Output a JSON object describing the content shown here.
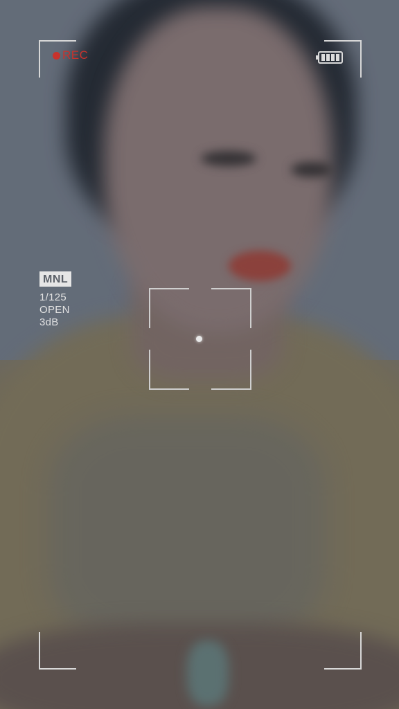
{
  "recording": {
    "label": "REC",
    "color": "#c8322c"
  },
  "battery": {
    "icon": "battery-icon",
    "level": "full"
  },
  "camera_settings": {
    "mode": "MNL",
    "shutter": "1/125",
    "aperture": "OPEN",
    "gain": "3dB"
  },
  "focus_frame": {
    "icon": "focus-frame"
  },
  "colors": {
    "overlay_text": "#e2e2e2",
    "frame_lines": "#d8d8d8"
  }
}
